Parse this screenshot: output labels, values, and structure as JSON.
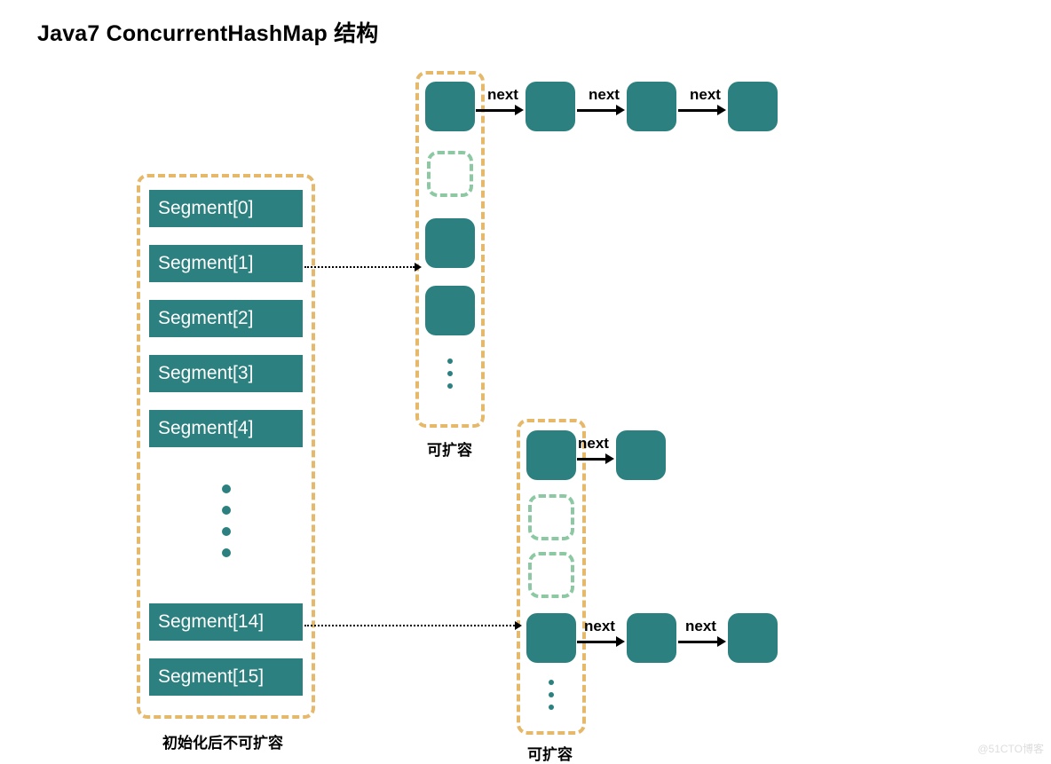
{
  "title": "Java7 ConcurrentHashMap 结构",
  "segments": {
    "s0": "Segment[0]",
    "s1": "Segment[1]",
    "s2": "Segment[2]",
    "s3": "Segment[3]",
    "s4": "Segment[4]",
    "s14": "Segment[14]",
    "s15": "Segment[15]"
  },
  "segments_caption": "初始化后不可扩容",
  "table_caption": "可扩容",
  "arrow_labels": {
    "next": "next"
  },
  "watermark": "@51CTO博客"
}
